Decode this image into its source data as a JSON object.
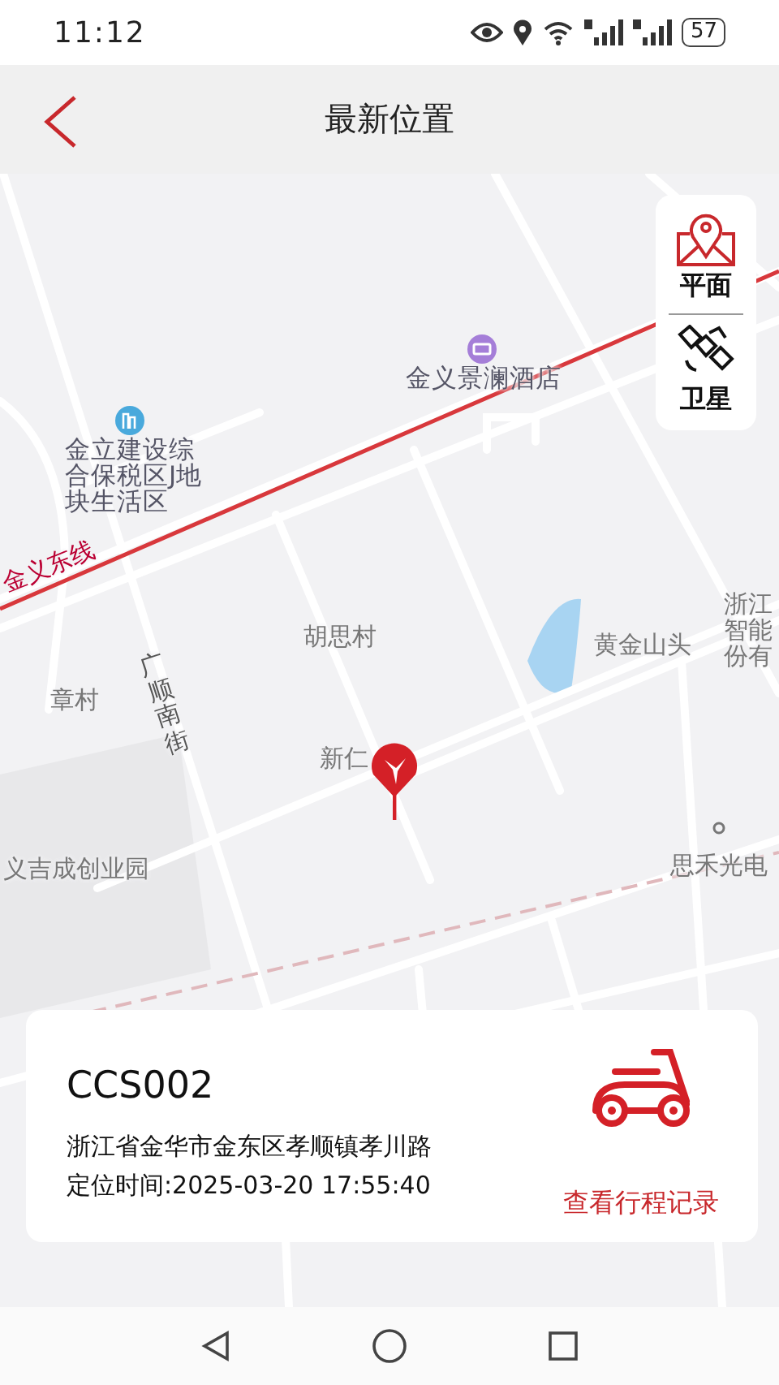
{
  "status_bar": {
    "time": "11:12",
    "battery": "57"
  },
  "header": {
    "title": "最新位置"
  },
  "map_types": [
    {
      "label": "平面",
      "selected": true
    },
    {
      "label": "卫星",
      "selected": false
    }
  ],
  "map_labels": [
    "金义景澜酒店",
    "金立建设综合保税区J地块生活区",
    "金义东线",
    "胡思村",
    "黄金山头",
    "浙江智能份有",
    "章村",
    "广顺南街",
    "新仁",
    "义吉成创业园",
    "思禾光电"
  ],
  "device": {
    "name": "CCS002",
    "address": "浙江省金华市金东区孝顺镇孝川路",
    "located_time": "定位时间:2025-03-20 17:55:40",
    "action": "查看行程记录"
  }
}
